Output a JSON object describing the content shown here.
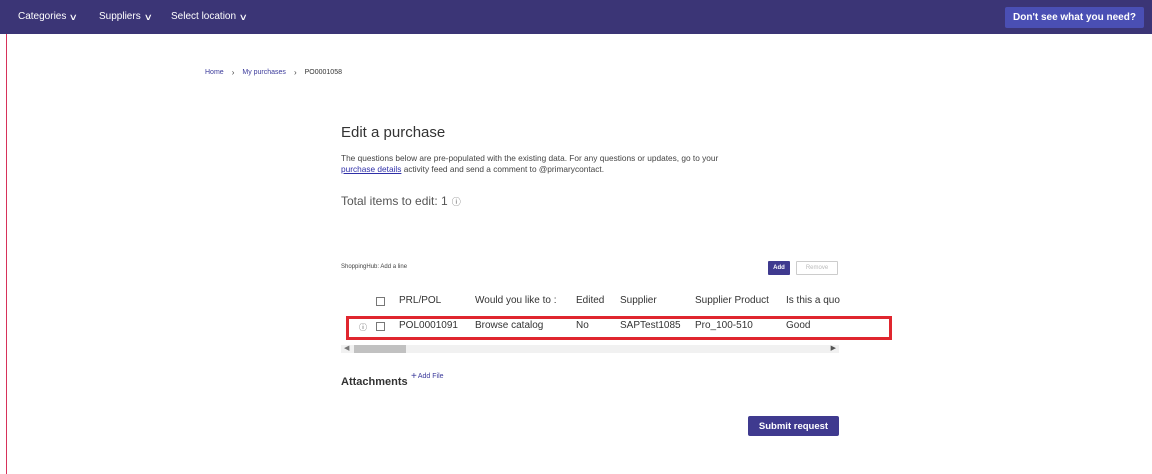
{
  "nav": {
    "categories": "Categories",
    "suppliers": "Suppliers",
    "location": "Select location",
    "help": "Don't see what you need?"
  },
  "breadcrumb": {
    "home": "Home",
    "purchases": "My purchases",
    "current": "PO0001058"
  },
  "page": {
    "title": "Edit a purchase",
    "intro_pre": "The questions below are pre-populated with the existing data.  For any questions or updates, go to your",
    "intro_link": "purchase details",
    "intro_post": "activity feed and send a comment to @primarycontact.",
    "total_label": "Total items to edit: 1"
  },
  "lines": {
    "caption": "ShoppingHub: Add a line",
    "add_label": "Add",
    "remove_label": "Remove",
    "headers": {
      "prl_pol": "PRL/POL",
      "would_like": "Would you like to :",
      "edited": "Edited",
      "supplier": "Supplier",
      "supplier_product": "Supplier Product",
      "is_quote": "Is this a quo"
    },
    "rows": [
      {
        "prl_pol": "POL0001091",
        "would_like": "Browse catalog",
        "edited": "No",
        "supplier": "SAPTest1085",
        "supplier_product": "Pro_100-510",
        "is_quote": "Good"
      }
    ]
  },
  "attachments": {
    "label": "Attachments",
    "add_file": "Add File"
  },
  "submit_label": "Submit request",
  "colors": {
    "topbar": "#3b3576",
    "accent": "#3f3a8f",
    "highlight": "#e0262e"
  }
}
